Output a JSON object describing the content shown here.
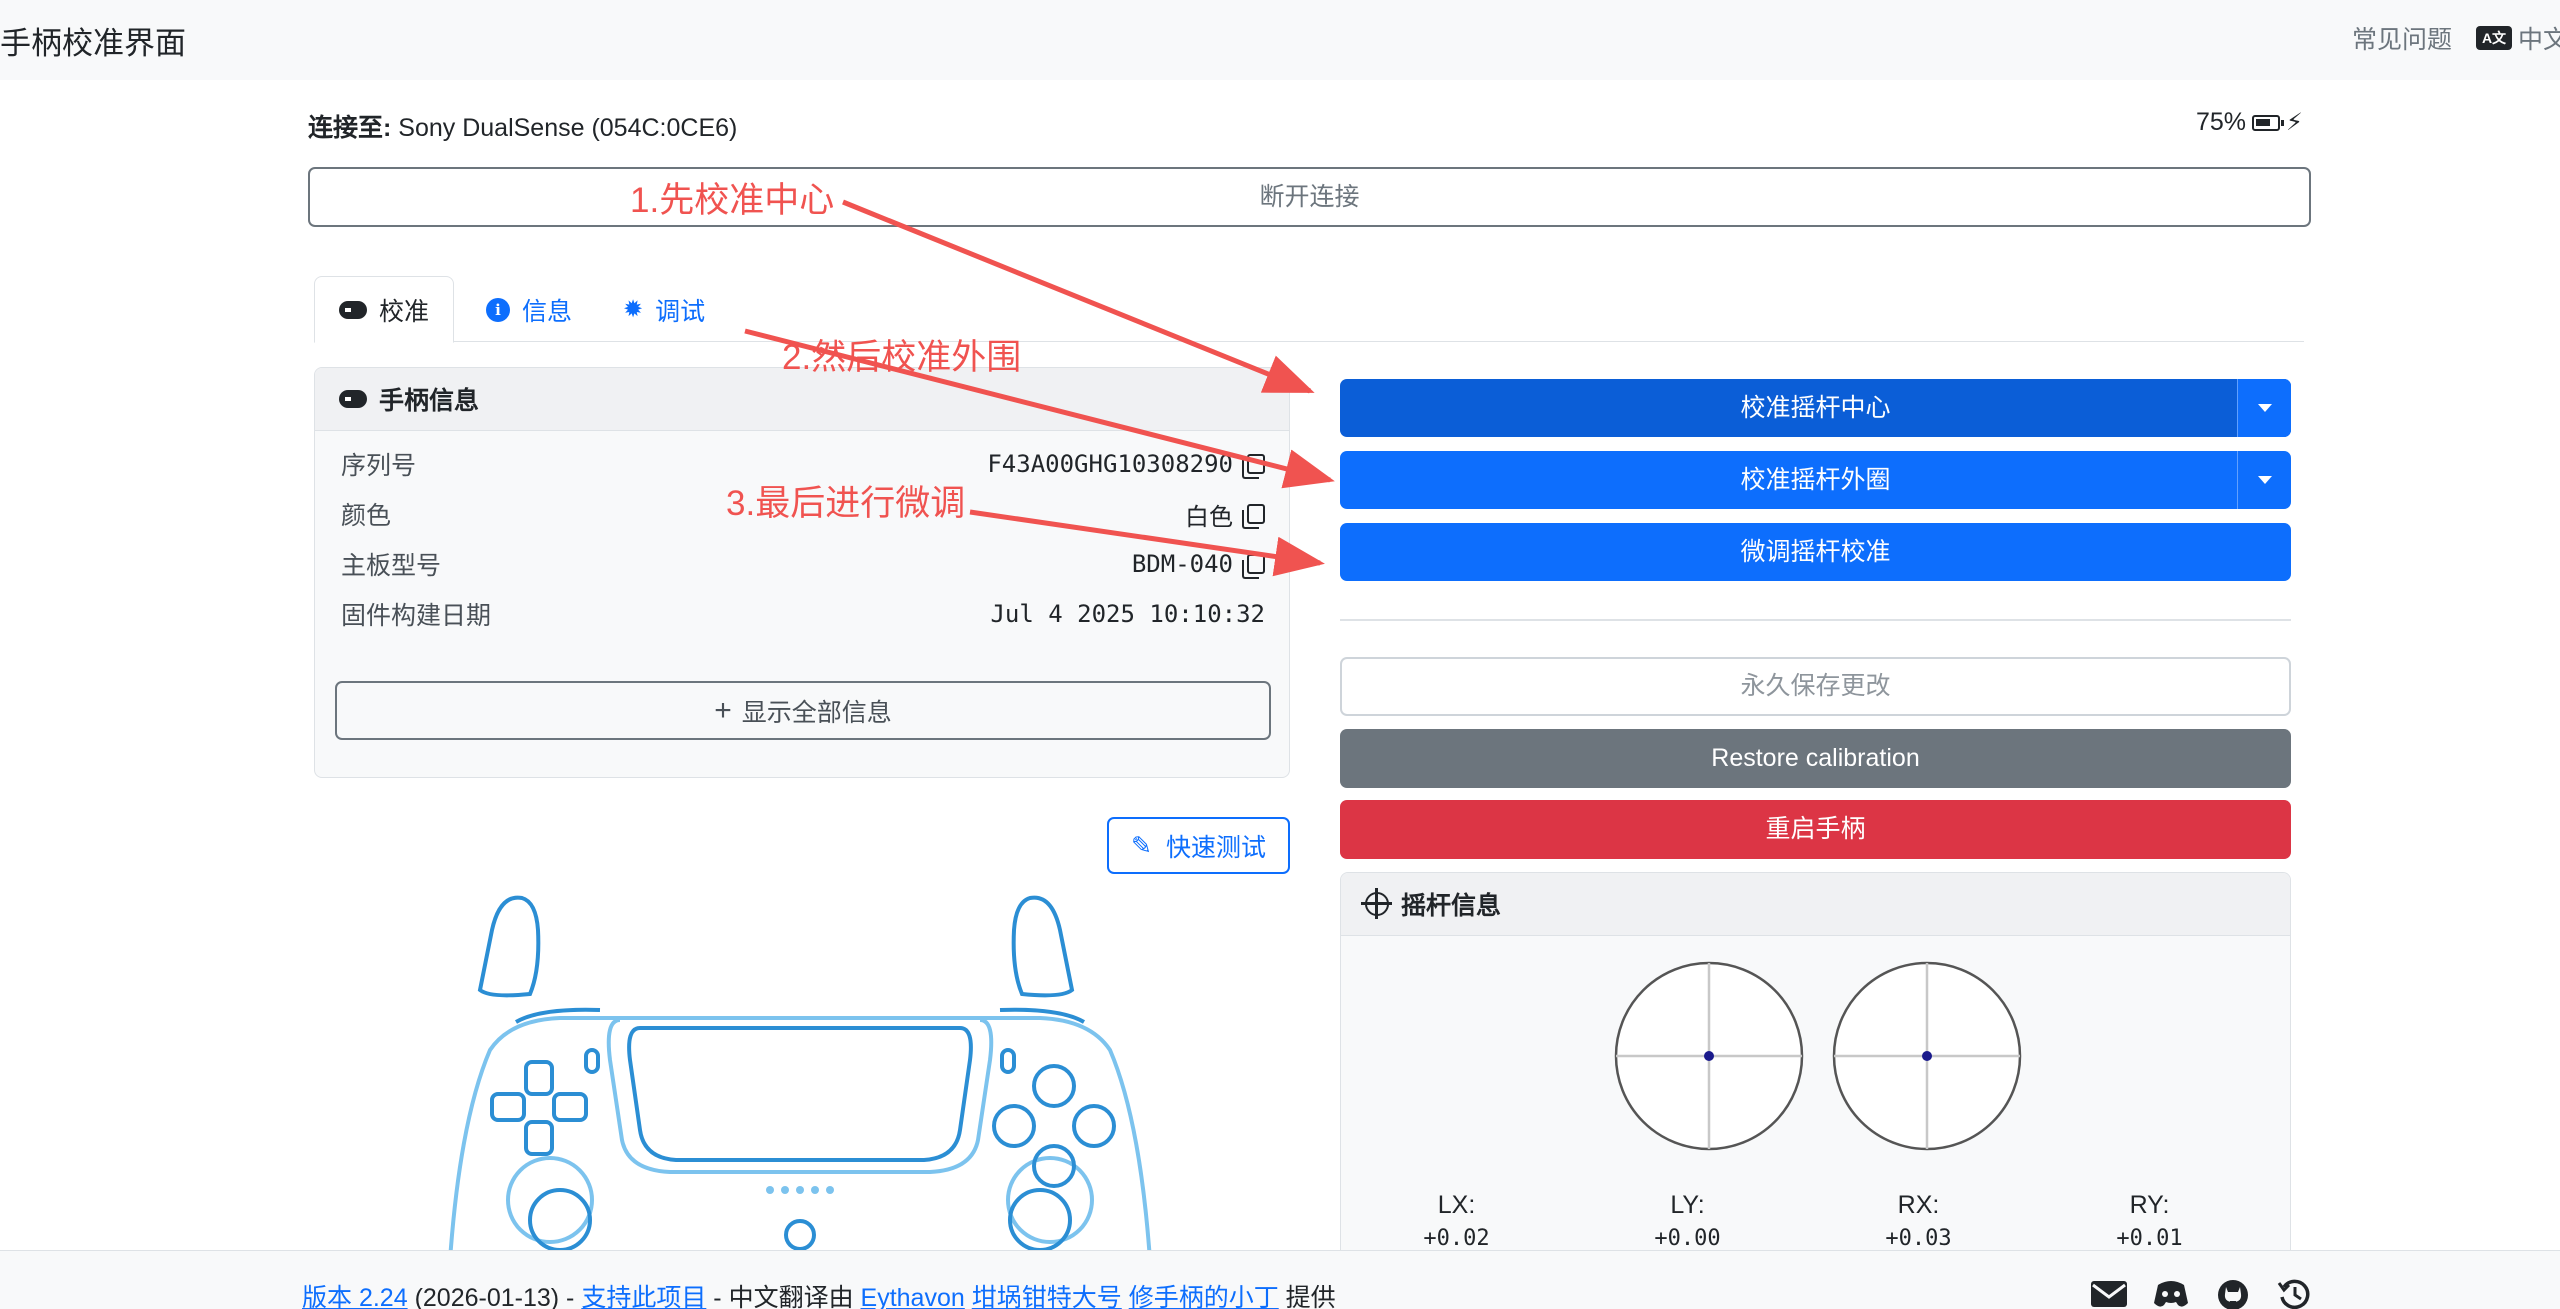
{
  "navbar": {
    "brand": "手柄校准界面",
    "faq": "常见问题",
    "language": "中文",
    "language_icon": "translate-icon"
  },
  "connection": {
    "label": "连接至:",
    "device": "Sony DualSense (054C:0CE6)",
    "battery": "75%",
    "disconnect": "断开连接"
  },
  "tabs": [
    {
      "label": "校准",
      "icon": "gamepad-icon",
      "active": true
    },
    {
      "label": "信息",
      "icon": "info-icon",
      "active": false
    },
    {
      "label": "调试",
      "icon": "bug-icon",
      "active": false
    }
  ],
  "controller_info": {
    "title": "手柄信息",
    "rows": [
      {
        "label": "序列号",
        "value": "F43A00GHG10308290"
      },
      {
        "label": "颜色",
        "value": "白色"
      },
      {
        "label": "主板型号",
        "value": "BDM-040"
      },
      {
        "label": "固件构建日期",
        "value": "Jul 4 2025 10:10:32"
      }
    ],
    "show_all": "显示全部信息"
  },
  "quick_test": "快速测试",
  "calibration": {
    "center": "校准摇杆中心",
    "range": "校准摇杆外圈",
    "finetune": "微调摇杆校准",
    "save": "永久保存更改",
    "restore": "Restore calibration",
    "reboot": "重启手柄"
  },
  "stick_info": {
    "title": "摇杆信息",
    "axes": [
      {
        "label": "LX:",
        "value": "+0.02"
      },
      {
        "label": "LY:",
        "value": "+0.00"
      },
      {
        "label": "RX:",
        "value": "+0.03"
      },
      {
        "label": "RY:",
        "value": "+0.01"
      }
    ]
  },
  "footer": {
    "version_link": "版本 2.24",
    "date": "(2026-01-13)",
    "sep1": "-",
    "support_link": "支持此项目",
    "translated_by": "- 中文翻译由",
    "translator1": "Eythavon",
    "translator2": "坩埚钳特大号",
    "translator3": "修手柄的小丁",
    "provided": "提供",
    "icons": [
      "mail-icon",
      "discord-icon",
      "github-icon",
      "history-icon"
    ]
  },
  "annotations": {
    "step1": "1.先校准中心",
    "step2": "2.然后校准外围",
    "step3": "3.最后进行微调",
    "color": "#f05350"
  },
  "colors": {
    "primary": "#0d6efd",
    "secondary": "#6c757d",
    "danger": "#dc3545"
  }
}
